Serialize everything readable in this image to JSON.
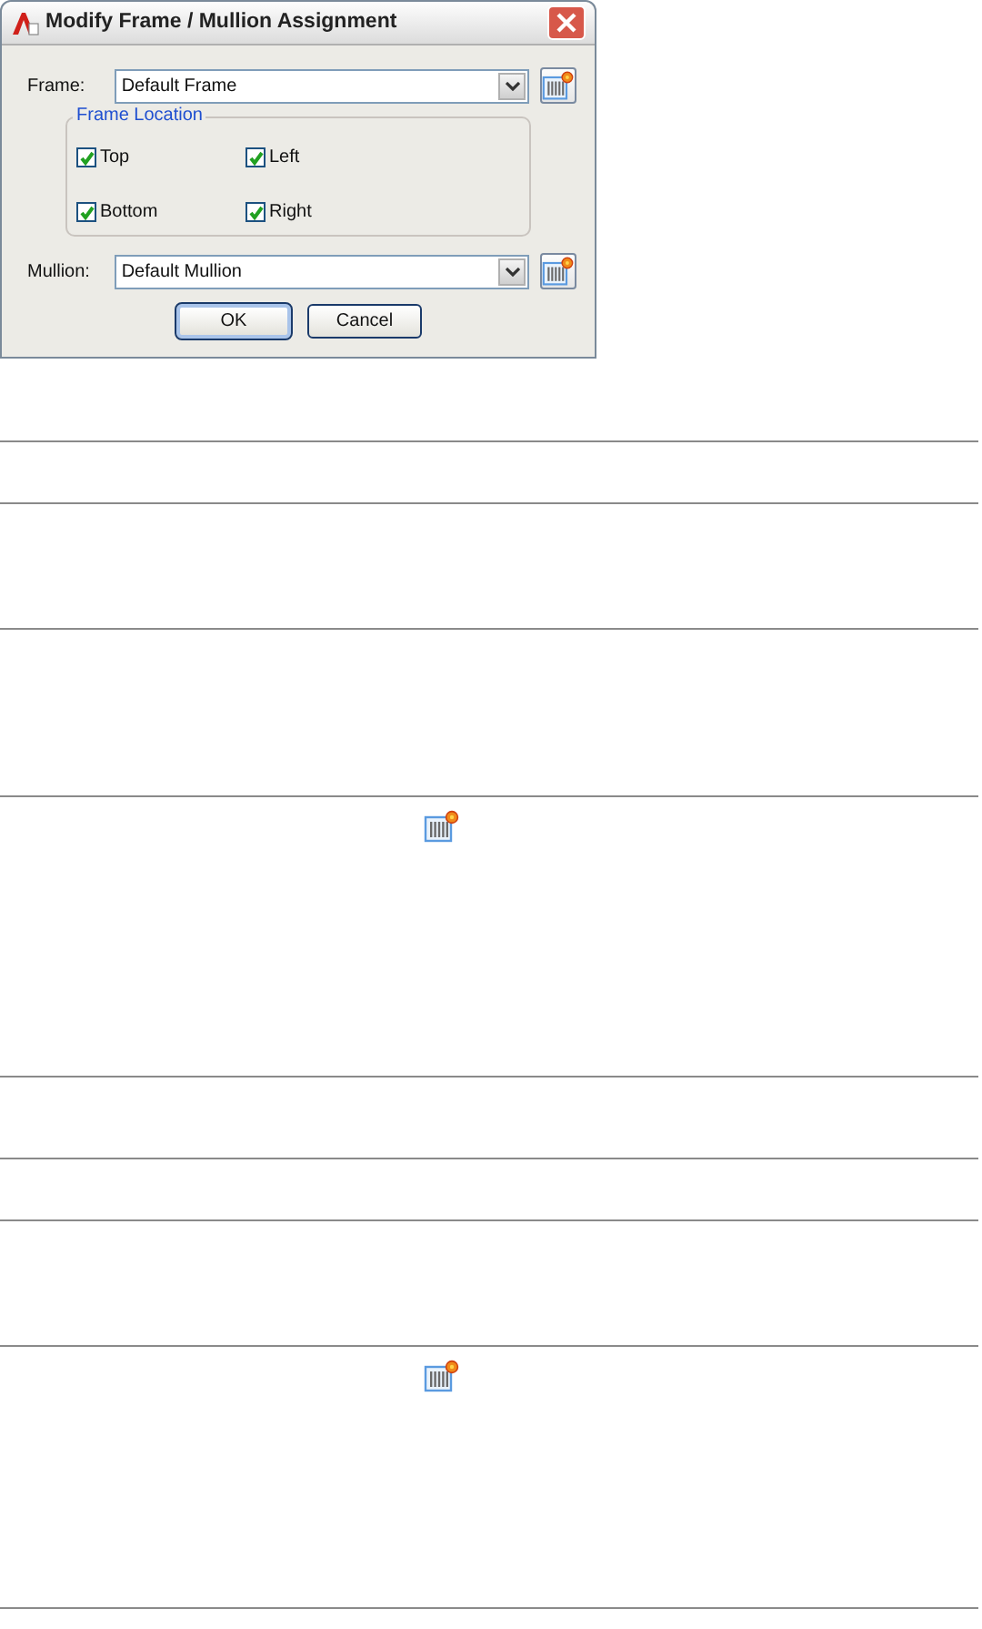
{
  "window": {
    "title": "Modify Frame / Mullion Assignment"
  },
  "frame": {
    "label": "Frame:",
    "value": "Default Frame"
  },
  "frame_location": {
    "title": "Frame Location",
    "checkboxes": [
      {
        "label": "Top",
        "checked": true
      },
      {
        "label": "Left",
        "checked": true
      },
      {
        "label": "Bottom",
        "checked": true
      },
      {
        "label": "Right",
        "checked": true
      }
    ]
  },
  "mullion": {
    "label": "Mullion:",
    "value": "Default Mullion"
  },
  "buttons": [
    {
      "label": "OK",
      "default": true
    },
    {
      "label": "Cancel",
      "default": false
    }
  ],
  "table": {
    "rows": [
      {
        "kind": "blank"
      },
      {
        "kind": "blank"
      },
      {
        "kind": "blank"
      },
      {
        "kind": "icon"
      },
      {
        "kind": "blank"
      },
      {
        "kind": "blank"
      },
      {
        "kind": "blank"
      },
      {
        "kind": "icon"
      }
    ]
  }
}
